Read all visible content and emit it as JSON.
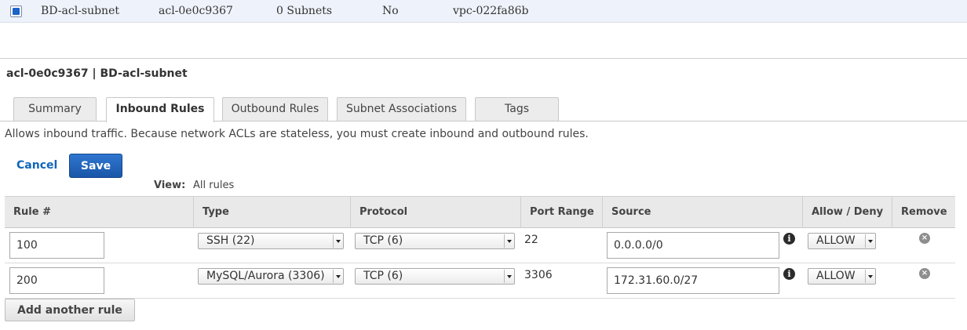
{
  "list_row": {
    "name": "BD-acl-subnet",
    "acl_id": "acl-0e0c9367",
    "subnets": "0 Subnets",
    "default": "No",
    "vpc": "vpc-022fa86b"
  },
  "detail": {
    "title": "acl-0e0c9367 | BD-acl-subnet"
  },
  "tabs": [
    {
      "label": "Summary",
      "active": false
    },
    {
      "label": "Inbound Rules",
      "active": true
    },
    {
      "label": "Outbound Rules",
      "active": false
    },
    {
      "label": "Subnet Associations",
      "active": false
    },
    {
      "label": "Tags",
      "active": false
    }
  ],
  "description": "Allows inbound traffic. Because network ACLs are stateless, you must create inbound and outbound rules.",
  "actions": {
    "cancel_label": "Cancel",
    "save_label": "Save"
  },
  "view": {
    "label": "View:",
    "value": "All rules"
  },
  "table": {
    "headers": [
      "Rule #",
      "Type",
      "Protocol",
      "Port Range",
      "Source",
      "Allow / Deny",
      "Remove"
    ],
    "rows": [
      {
        "rule": "100",
        "type": "SSH (22)",
        "protocol": "TCP (6)",
        "port_range": "22",
        "source": "0.0.0.0/0",
        "action": "ALLOW"
      },
      {
        "rule": "200",
        "type": "MySQL/Aurora (3306)",
        "protocol": "TCP (6)",
        "port_range": "3306",
        "source": "172.31.60.0/27",
        "action": "ALLOW"
      }
    ]
  },
  "add_rule_label": "Add another rule",
  "icons": {
    "info": "info-icon",
    "remove": "remove-icon"
  },
  "colors": {
    "accent": "#1f5fb7",
    "link": "#1166bb",
    "selected_row": "#eef2fa"
  }
}
